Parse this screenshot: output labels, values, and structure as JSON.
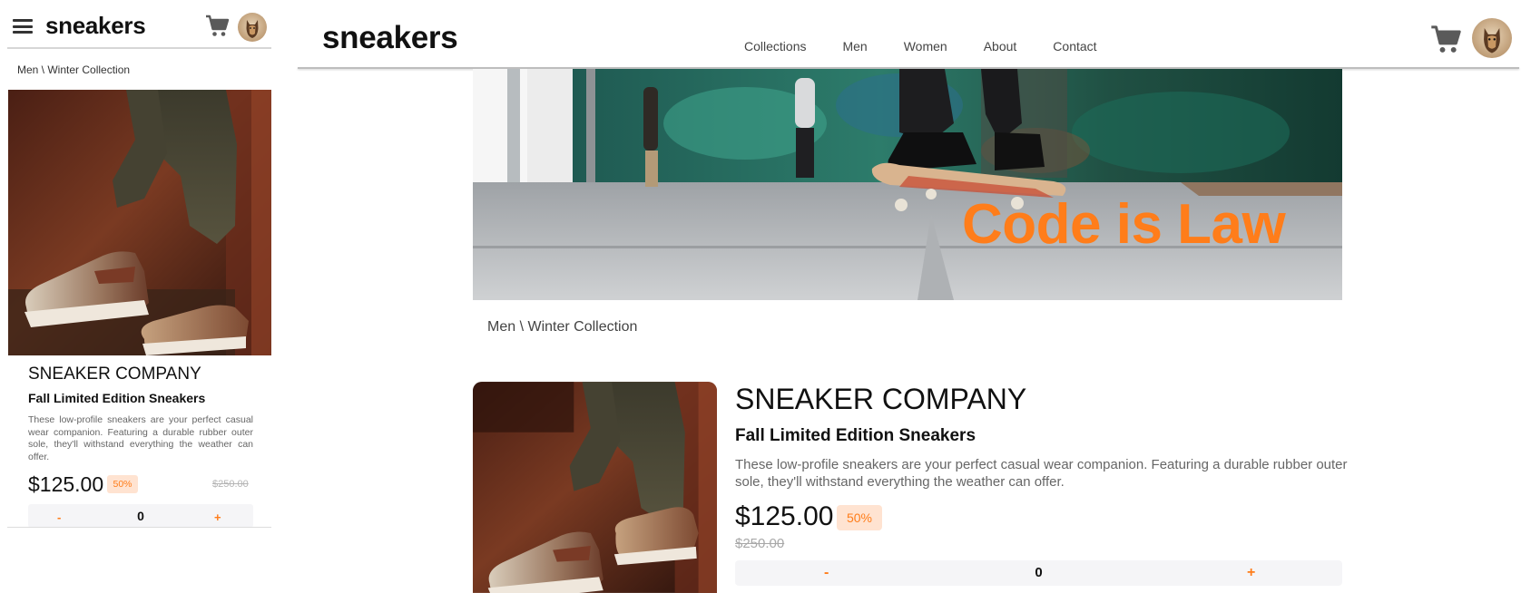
{
  "colors": {
    "accent": "#ff7d1a",
    "accent_pale": "#ffe3d1",
    "text_dark": "#111111",
    "text_muted": "#666666"
  },
  "mobile": {
    "logo": "sneakers",
    "menu_icon": "hamburger-menu-icon",
    "cart_icon": "cart-icon",
    "breadcrumb": "Men \\ Winter Collection",
    "product": {
      "brand": "SNEAKER COMPANY",
      "title": "Fall Limited Edition Sneakers",
      "description": "These low-profile sneakers are your perfect casual wear companion. Featuring a durable rubber outer sole, they'll withstand everything the weather can offer.",
      "price": "$125.00",
      "discount": "50%",
      "old_price": "$250.00",
      "quantity": "0",
      "minus_label": "-",
      "plus_label": "+"
    }
  },
  "desktop": {
    "logo": "sneakers",
    "nav": [
      "Collections",
      "Men",
      "Women",
      "About",
      "Contact"
    ],
    "cart_icon": "cart-icon",
    "hero_text": "Code is Law",
    "breadcrumb": "Men \\ Winter Collection",
    "product": {
      "brand": "SNEAKER COMPANY",
      "title": "Fall Limited Edition Sneakers",
      "description": "These low-profile sneakers are your perfect casual wear companion. Featuring a durable rubber outer sole, they'll withstand everything the weather can offer.",
      "price": "$125.00",
      "discount": "50%",
      "old_price": "$250.00",
      "quantity": "0",
      "minus_label": "-",
      "plus_label": "+"
    }
  }
}
